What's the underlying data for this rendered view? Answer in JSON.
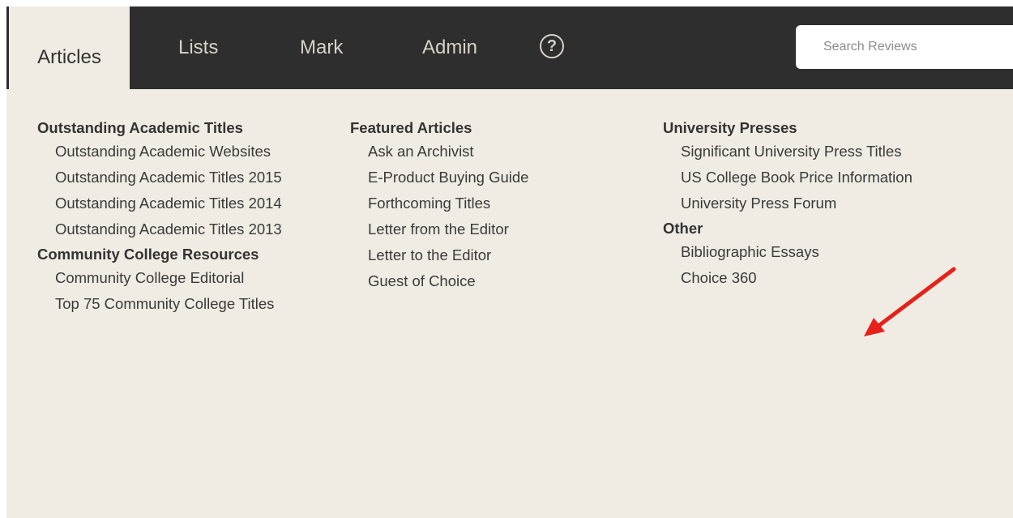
{
  "nav": {
    "tabs": [
      {
        "label": "Articles"
      },
      {
        "label": "Lists"
      },
      {
        "label": "Mark"
      },
      {
        "label": "Admin"
      }
    ],
    "help_glyph": "?",
    "search_placeholder": "Search Reviews"
  },
  "columns": [
    {
      "sections": [
        {
          "title": "Outstanding Academic Titles",
          "links": [
            "Outstanding Academic Websites",
            "Outstanding Academic Titles 2015",
            "Outstanding Academic Titles 2014",
            "Outstanding Academic Titles 2013"
          ]
        },
        {
          "title": "Community College Resources",
          "links": [
            "Community College Editorial",
            "Top 75 Community College Titles"
          ]
        }
      ]
    },
    {
      "sections": [
        {
          "title": "Featured Articles",
          "links": [
            "Ask an Archivist",
            "E-Product Buying Guide",
            "Forthcoming Titles",
            "Letter from the Editor",
            "Letter to the Editor",
            "Guest of Choice"
          ]
        }
      ]
    },
    {
      "sections": [
        {
          "title": "University Presses",
          "links": [
            "Significant University Press Titles",
            "US College Book Price Information",
            "University Press Forum"
          ]
        },
        {
          "title": "Other",
          "links": [
            "Bibliographic Essays",
            "Choice 360"
          ]
        }
      ]
    }
  ],
  "colors": {
    "navbar": "#2e2e2e",
    "panel": "#f0ece4",
    "annotation_arrow": "#e8201a"
  },
  "icons": {
    "help": "question-circle-icon",
    "annotation": "red-arrow-annotation"
  }
}
